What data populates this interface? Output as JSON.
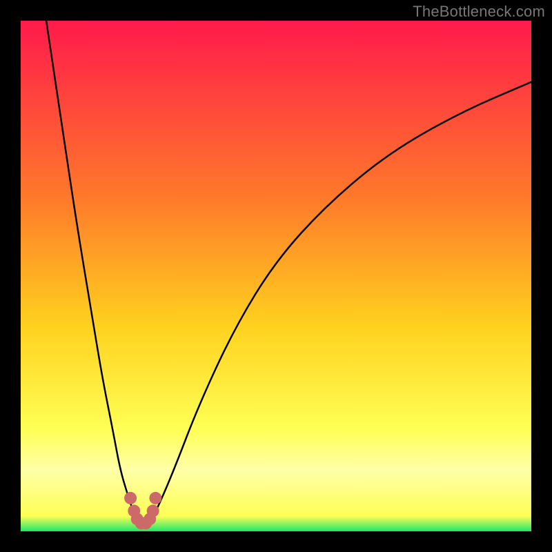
{
  "watermark": "TheBottleneck.com",
  "colors": {
    "frame": "#000000",
    "gradient_top": "#ff1a4b",
    "gradient_mid_upper": "#ff7a2a",
    "gradient_mid": "#ffd21f",
    "gradient_mid_lower": "#ffff55",
    "gradient_band": "#ffffa8",
    "gradient_bottom": "#1ee66a",
    "curve": "#000000",
    "marker": "#cc6a6a"
  },
  "chart_data": {
    "type": "line",
    "title": "",
    "xlabel": "",
    "ylabel": "",
    "xlim": [
      0,
      100
    ],
    "ylim": [
      0,
      100
    ],
    "series": [
      {
        "name": "left-branch",
        "x": [
          5,
          8,
          11,
          14,
          16,
          18,
          19.5,
          21,
          22,
          22.8
        ],
        "y": [
          100,
          80,
          60,
          42,
          30,
          20,
          12,
          7,
          4,
          2.2
        ]
      },
      {
        "name": "right-branch",
        "x": [
          25.5,
          27,
          30,
          35,
          42,
          50,
          60,
          72,
          86,
          100
        ],
        "y": [
          2.2,
          5,
          12,
          25,
          40,
          53,
          64,
          74,
          82,
          88
        ]
      },
      {
        "name": "valley-floor",
        "x": [
          22.8,
          23.6,
          24.5,
          25.5
        ],
        "y": [
          2.2,
          1.5,
          1.5,
          2.2
        ]
      }
    ],
    "markers": {
      "name": "valley-markers",
      "points": [
        {
          "x": 21.5,
          "y": 6.5
        },
        {
          "x": 22.2,
          "y": 4.0
        },
        {
          "x": 22.8,
          "y": 2.4
        },
        {
          "x": 23.6,
          "y": 1.6
        },
        {
          "x": 24.5,
          "y": 1.6
        },
        {
          "x": 25.3,
          "y": 2.4
        },
        {
          "x": 25.9,
          "y": 4.0
        },
        {
          "x": 26.4,
          "y": 6.5
        }
      ],
      "radius_px": 9
    },
    "background_gradient": {
      "stops": [
        {
          "offset": 0.0,
          "color_key": "gradient_top"
        },
        {
          "offset": 0.35,
          "color_key": "gradient_mid_upper"
        },
        {
          "offset": 0.6,
          "color_key": "gradient_mid"
        },
        {
          "offset": 0.8,
          "color_key": "gradient_mid_lower"
        },
        {
          "offset": 0.88,
          "color_key": "gradient_band"
        },
        {
          "offset": 0.97,
          "color_key": "gradient_mid_lower"
        },
        {
          "offset": 1.0,
          "color_key": "gradient_bottom"
        }
      ]
    }
  }
}
